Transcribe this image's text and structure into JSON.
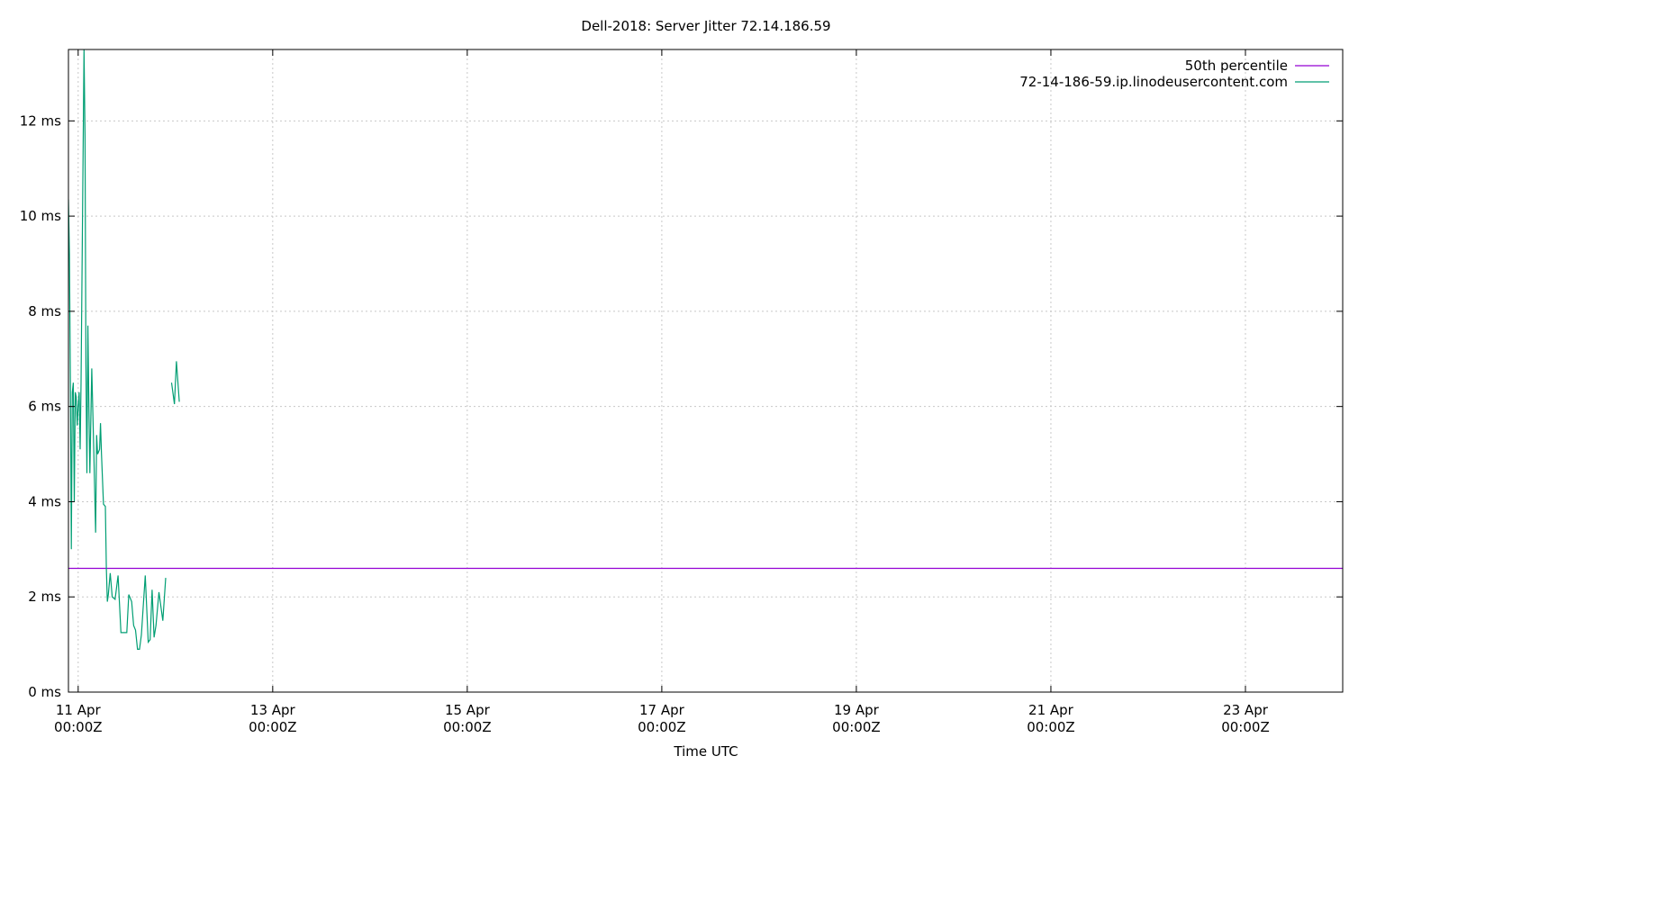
{
  "chart_data": {
    "type": "line",
    "title": "Dell-2018: Server Jitter 72.14.186.59",
    "xlabel": "Time UTC",
    "ylabel": "",
    "x_unit": "days since 11 Apr 00:00Z",
    "xlim": [
      -0.1,
      13
    ],
    "ylim": [
      0,
      13.5
    ],
    "grid": true,
    "legend_position": "top-right",
    "y_ticks": [
      {
        "value": 0,
        "label": "0 ms"
      },
      {
        "value": 2,
        "label": "2 ms"
      },
      {
        "value": 4,
        "label": "4 ms"
      },
      {
        "value": 6,
        "label": "6 ms"
      },
      {
        "value": 8,
        "label": "8 ms"
      },
      {
        "value": 10,
        "label": "10 ms"
      },
      {
        "value": 12,
        "label": "12 ms"
      }
    ],
    "x_ticks": [
      {
        "value": 0,
        "date": "11 Apr",
        "time": "00:00Z"
      },
      {
        "value": 2,
        "date": "13 Apr",
        "time": "00:00Z"
      },
      {
        "value": 4,
        "date": "15 Apr",
        "time": "00:00Z"
      },
      {
        "value": 6,
        "date": "17 Apr",
        "time": "00:00Z"
      },
      {
        "value": 8,
        "date": "19 Apr",
        "time": "00:00Z"
      },
      {
        "value": 10,
        "date": "21 Apr",
        "time": "00:00Z"
      },
      {
        "value": 12,
        "date": "23 Apr",
        "time": "00:00Z"
      }
    ],
    "series": [
      {
        "name": "50th percentile",
        "color": "#9400d3",
        "segments": [
          [
            [
              -0.1,
              2.6
            ],
            [
              13,
              2.6
            ]
          ]
        ]
      },
      {
        "name": "72-14-186-59.ip.linodeusercontent.com",
        "color": "#009e73",
        "segments": [
          [
            [
              -0.1,
              10.35
            ],
            [
              -0.09,
              9.2
            ],
            [
              -0.08,
              6.4
            ],
            [
              -0.07,
              3.0
            ],
            [
              -0.06,
              6.3
            ],
            [
              -0.05,
              6.5
            ],
            [
              -0.04,
              4.0
            ],
            [
              -0.03,
              6.3
            ],
            [
              -0.02,
              6.2
            ],
            [
              -0.01,
              5.6
            ],
            [
              0.0,
              6.0
            ],
            [
              0.01,
              6.3
            ],
            [
              0.02,
              5.1
            ],
            [
              0.03,
              6.5
            ],
            [
              0.06,
              13.5
            ],
            [
              0.07,
              11.7
            ],
            [
              0.08,
              6.9
            ],
            [
              0.09,
              4.6
            ],
            [
              0.1,
              7.7
            ],
            [
              0.11,
              6.0
            ],
            [
              0.12,
              4.6
            ],
            [
              0.14,
              6.8
            ],
            [
              0.16,
              5.1
            ],
            [
              0.18,
              3.35
            ],
            [
              0.19,
              5.4
            ],
            [
              0.2,
              5.0
            ],
            [
              0.22,
              5.1
            ],
            [
              0.23,
              5.65
            ],
            [
              0.24,
              5.0
            ],
            [
              0.26,
              3.95
            ],
            [
              0.28,
              3.9
            ],
            [
              0.29,
              2.6
            ],
            [
              0.3,
              1.9
            ],
            [
              0.31,
              2.05
            ],
            [
              0.33,
              2.5
            ],
            [
              0.35,
              2.0
            ],
            [
              0.38,
              1.95
            ],
            [
              0.41,
              2.45
            ],
            [
              0.44,
              1.25
            ],
            [
              0.48,
              1.25
            ],
            [
              0.5,
              1.25
            ],
            [
              0.52,
              2.05
            ],
            [
              0.55,
              1.9
            ],
            [
              0.57,
              1.4
            ],
            [
              0.59,
              1.3
            ],
            [
              0.61,
              0.9
            ],
            [
              0.63,
              0.9
            ],
            [
              0.65,
              1.2
            ],
            [
              0.69,
              2.45
            ],
            [
              0.72,
              1.05
            ],
            [
              0.74,
              1.1
            ],
            [
              0.76,
              2.15
            ],
            [
              0.78,
              1.15
            ],
            [
              0.8,
              1.4
            ],
            [
              0.83,
              2.1
            ],
            [
              0.87,
              1.5
            ],
            [
              0.9,
              2.4
            ]
          ],
          [
            [
              0.96,
              6.5
            ],
            [
              0.99,
              6.05
            ],
            [
              1.01,
              6.95
            ],
            [
              1.04,
              6.1
            ]
          ]
        ]
      }
    ]
  }
}
